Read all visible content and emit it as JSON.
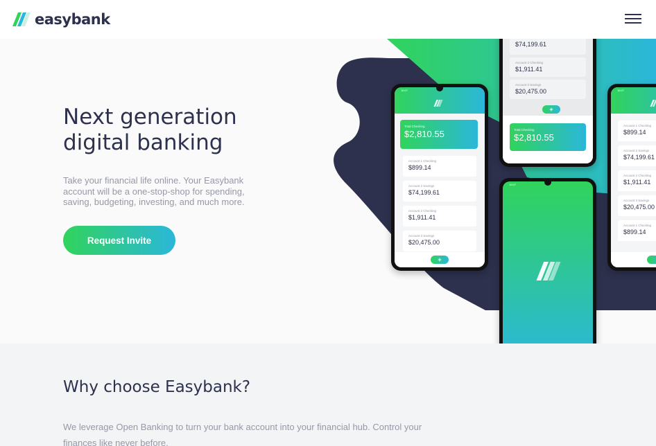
{
  "brand": {
    "name": "easybank",
    "colors": {
      "primary": "#2d314d",
      "green": "#31d35c",
      "cyan": "#2bb7da",
      "grey_text": "#9698a6"
    }
  },
  "header": {
    "logo_icon": "easybank-logo-icon",
    "menu_icon": "hamburger-menu-icon"
  },
  "hero": {
    "title": "Next generation digital banking",
    "description": "Take your financial life online. Your Easybank account will be a one-stop-shop for spending, saving, budgeting, investing, and much more.",
    "cta_label": "Request Invite"
  },
  "mockups": {
    "left_phone": {
      "status_time": "16:07",
      "total_label": "Total Checking",
      "total": "$2,810.55",
      "accounts": [
        {
          "label": "Account 1 Checking",
          "amount": "$899.14"
        },
        {
          "label": "Account 2 Savings",
          "amount": "$74,199.61"
        },
        {
          "label": "Account 2 Checking",
          "amount": "$1,911.41"
        },
        {
          "label": "Account 3 Savings",
          "amount": "$20,475.00"
        }
      ],
      "fab": "+"
    },
    "top_phone": {
      "accounts": [
        {
          "label": "",
          "amount": "$74,199.61"
        },
        {
          "label": "Account 2 Checking",
          "amount": "$1,911.41"
        },
        {
          "label": "Account 3 Savings",
          "amount": "$20,475.00"
        }
      ],
      "fab": "+",
      "total_label": "Total Checking",
      "total": "$2,810.55"
    },
    "center_phone": {
      "status_time": "16:07"
    },
    "right_phone": {
      "status_time": "16:07",
      "accounts": [
        {
          "label": "Account 1 Checking",
          "amount": "$899.14"
        },
        {
          "label": "Account 2 Savings",
          "amount": "$74,199.61"
        },
        {
          "label": "Account 2 Checking",
          "amount": "$1,911.41"
        },
        {
          "label": "Account 3 Savings",
          "amount": "$20,475.00"
        },
        {
          "label": "Account 1 Checking",
          "amount": "$899.14"
        }
      ]
    }
  },
  "why": {
    "title": "Why choose Easybank?",
    "description": "We leverage Open Banking to turn your bank account into your financial hub. Control your finances like never before."
  }
}
